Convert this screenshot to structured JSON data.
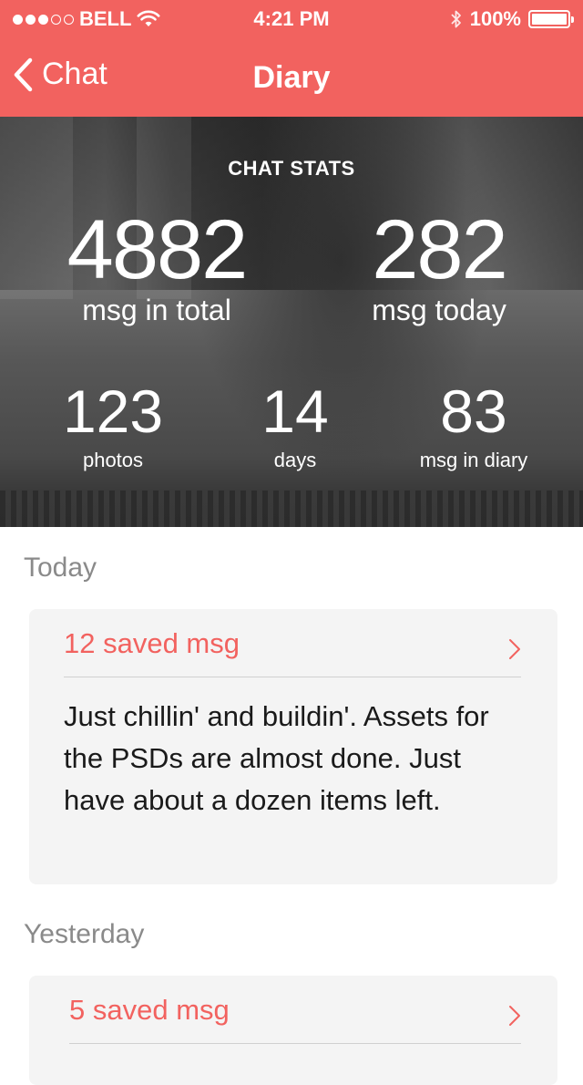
{
  "status": {
    "carrier": "BELL",
    "time": "4:21 PM",
    "battery": "100%",
    "signal_full": 3,
    "signal_empty": 2
  },
  "nav": {
    "back_label": "Chat",
    "title": "Diary"
  },
  "stats": {
    "title": "CHAT STATS",
    "total": {
      "value": "4882",
      "label": "msg in total"
    },
    "today": {
      "value": "282",
      "label": "msg today"
    },
    "photos": {
      "value": "123",
      "label": "photos"
    },
    "days": {
      "value": "14",
      "label": "days"
    },
    "diary": {
      "value": "83",
      "label": "msg in diary"
    }
  },
  "sections": [
    {
      "label": "Today",
      "count": "12 saved msg",
      "body": "Just chillin' and buildin'. Assets for the PSDs are almost done. Just have about a dozen items left."
    },
    {
      "label": "Yesterday",
      "count": "5 saved msg"
    }
  ],
  "colors": {
    "accent": "#f2625f",
    "card": "#f4f4f4",
    "section_label": "#8a8a8a"
  }
}
